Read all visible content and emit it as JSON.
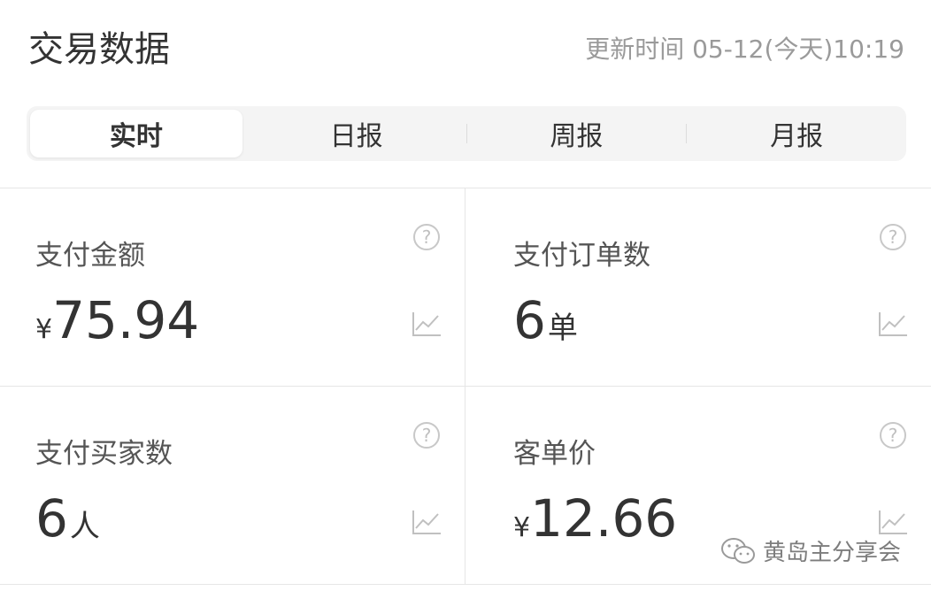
{
  "header": {
    "title": "交易数据",
    "update_time": "更新时间 05-12(今天)10:19"
  },
  "tabs": [
    {
      "label": "实时",
      "active": true
    },
    {
      "label": "日报",
      "active": false
    },
    {
      "label": "周报",
      "active": false
    },
    {
      "label": "月报",
      "active": false
    }
  ],
  "metrics": [
    {
      "label": "支付金额",
      "prefix": "¥",
      "value": "75.94",
      "unit": "",
      "help_icon": "question-circle-icon",
      "trend_icon": "line-chart-icon"
    },
    {
      "label": "支付订单数",
      "prefix": "",
      "value": "6",
      "unit": "单",
      "help_icon": "question-circle-icon",
      "trend_icon": "line-chart-icon"
    },
    {
      "label": "支付买家数",
      "prefix": "",
      "value": "6",
      "unit": "人",
      "help_icon": "question-circle-icon",
      "trend_icon": "line-chart-icon"
    },
    {
      "label": "客单价",
      "prefix": "¥",
      "value": "12.66",
      "unit": "",
      "help_icon": "question-circle-icon",
      "trend_icon": "line-chart-icon"
    }
  ],
  "watermark": {
    "text": "黄岛主分享会",
    "icon": "wechat-icon"
  },
  "colors": {
    "text_primary": "#333333",
    "text_secondary": "#9a9a9a",
    "tab_background": "#f4f4f4",
    "divider": "#e6e6e6",
    "icon": "#c0c0c0"
  },
  "help_glyph": "?"
}
